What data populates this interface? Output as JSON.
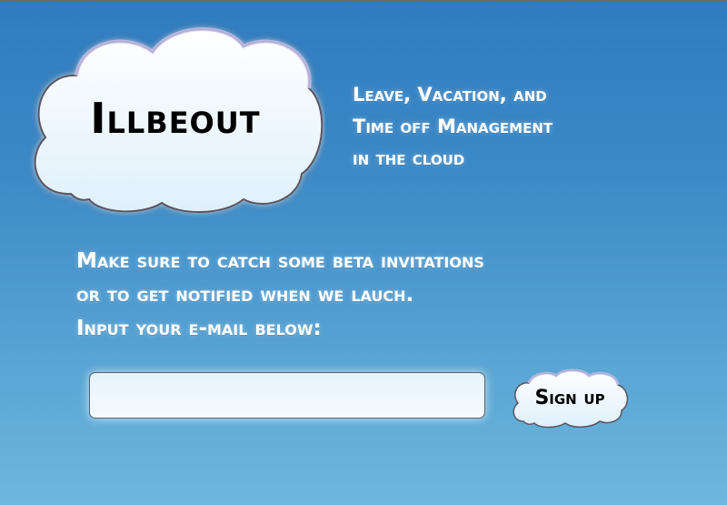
{
  "logo": {
    "text": "Illbeout"
  },
  "tagline": {
    "lines": [
      "Leave, Vacation, and",
      "Time off Management",
      "in the cloud"
    ]
  },
  "invite": {
    "lines": [
      "Make sure to catch some beta invitations",
      "or to get notified when we lauch.",
      "Input your e-mail below:"
    ]
  },
  "signup_form": {
    "email_value": "",
    "button_label": "Sign up"
  },
  "colors": {
    "background_top": "#2f7bbf",
    "background_bottom": "#6cb8df",
    "cloud_fill": "#eef7fd",
    "cloud_outline": "#5a5560",
    "text_light": "#ffffff"
  }
}
